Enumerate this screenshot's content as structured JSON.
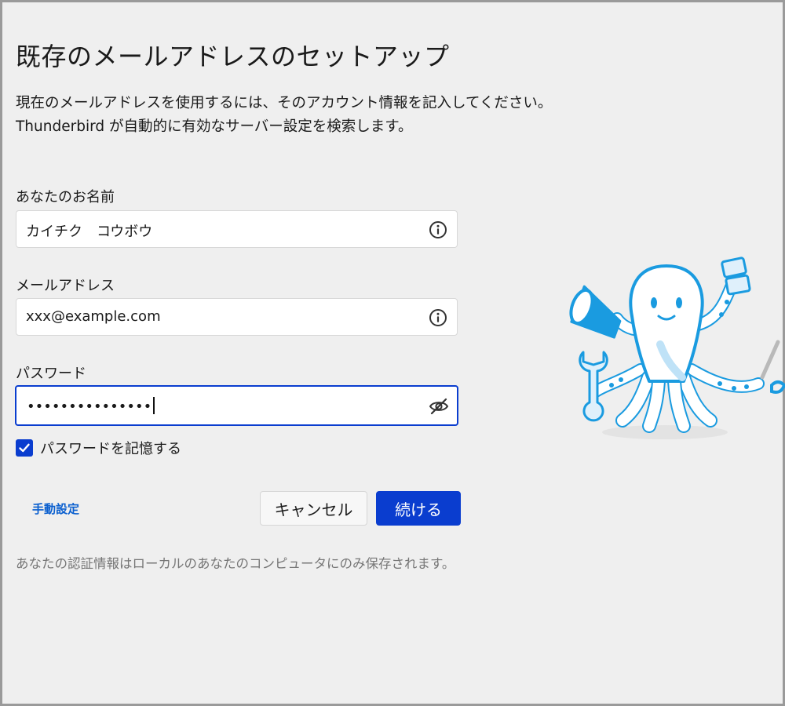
{
  "title": "既存のメールアドレスのセットアップ",
  "description": {
    "line1": "現在のメールアドレスを使用するには、そのアカウント情報を記入してください。",
    "line2": "Thunderbird が自動的に有効なサーバー設定を検索します。"
  },
  "fields": {
    "name": {
      "label": "あなたのお名前",
      "value": "カイチク　コウボウ",
      "icon": "info-icon"
    },
    "email": {
      "label": "メールアドレス",
      "value": "xxx@example.com",
      "icon": "info-icon"
    },
    "password": {
      "label": "パスワード",
      "value": "•••••••••••••••",
      "icon": "eye-slash-icon",
      "focused": true
    }
  },
  "remember_password": {
    "label": "パスワードを記憶する",
    "checked": true
  },
  "actions": {
    "manual_config": "手動設定",
    "cancel": "キャンセル",
    "continue": "続ける"
  },
  "note": "あなたの認証情報はローカルのあなたのコンピュータにのみ保存されます。",
  "colors": {
    "accent": "#0a3dcf",
    "link": "#0a5fcf",
    "background": "#efefef",
    "mascot": "#1a9be0"
  },
  "illustration": "thunderbird-octopus-mascot"
}
